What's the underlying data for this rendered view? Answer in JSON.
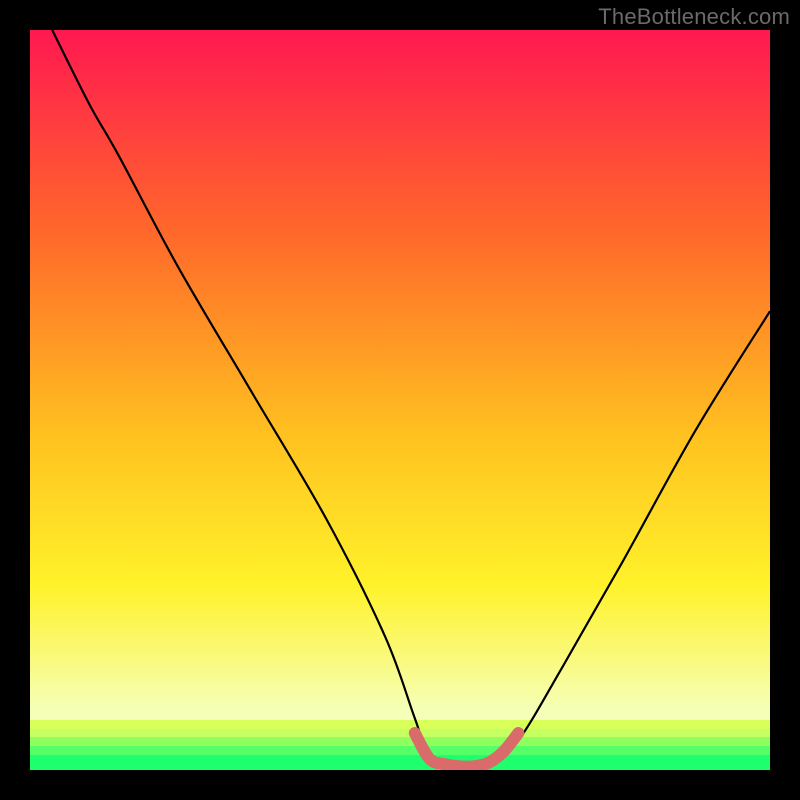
{
  "watermark": "TheBottleneck.com",
  "colors": {
    "frame": "#000000",
    "gradient_top": "#ff1850",
    "gradient_mid1": "#ff6a2a",
    "gradient_mid2": "#ffc220",
    "gradient_mid3": "#fff22a",
    "gradient_bottom": "#f6ffb8",
    "green_light": "#d9ff5a",
    "green_mid": "#8fff60",
    "green_deep": "#1eff6e",
    "curve": "#000000",
    "highlight": "#d96b6b"
  },
  "chart_data": {
    "type": "line",
    "title": "",
    "xlabel": "",
    "ylabel": "",
    "xlim": [
      0,
      100
    ],
    "ylim": [
      0,
      100
    ],
    "series": [
      {
        "name": "bottleneck-curve",
        "x": [
          3,
          8,
          12,
          20,
          30,
          40,
          48,
          52,
          54,
          58,
          62,
          66,
          72,
          80,
          90,
          100
        ],
        "y": [
          100,
          90,
          83,
          68,
          51,
          34,
          18,
          7,
          2,
          0.5,
          0.5,
          4,
          14,
          28,
          46,
          62
        ]
      },
      {
        "name": "highlight-segment",
        "x": [
          52,
          54,
          56,
          58,
          60,
          62,
          64,
          66
        ],
        "y": [
          5,
          1.5,
          0.8,
          0.5,
          0.5,
          1,
          2.5,
          5
        ]
      }
    ],
    "annotations": []
  }
}
